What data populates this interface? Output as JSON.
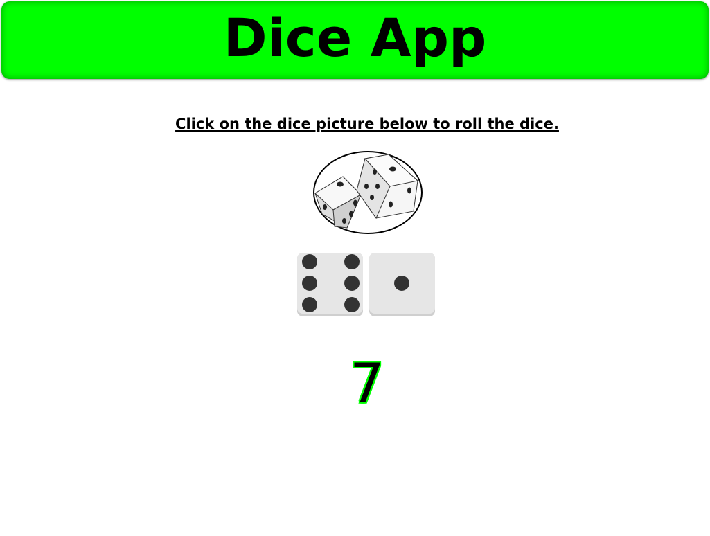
{
  "app": {
    "title": "Dice App"
  },
  "instruction": {
    "text": "Click on the dice picture below to roll the dice."
  },
  "roll_image": {
    "icon": "two-dice-roll-icon"
  },
  "dice": [
    {
      "value": 6,
      "icon": "die-six-icon"
    },
    {
      "value": 1,
      "icon": "die-one-icon"
    }
  ],
  "result": {
    "total": "7"
  },
  "colors": {
    "header_bg": "#00ff00",
    "total_outline": "#00ff00",
    "die_face": "#e6e6e6",
    "pip": "#333333"
  }
}
